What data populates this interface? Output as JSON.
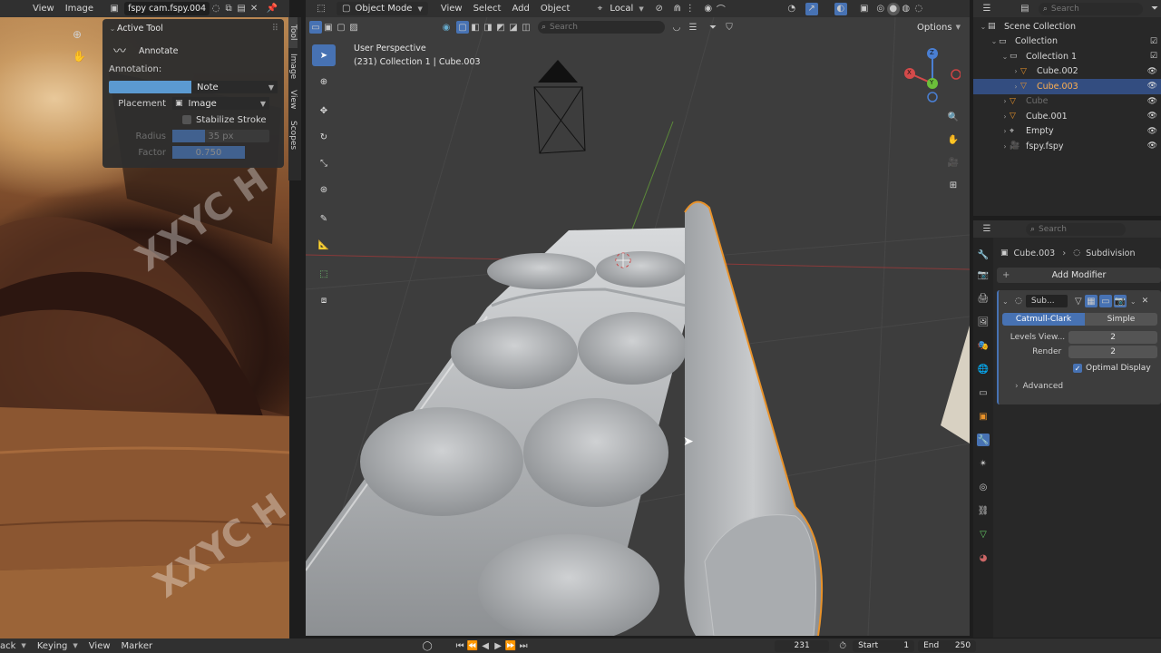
{
  "image_editor": {
    "menus": [
      "View",
      "Image"
    ],
    "image_name": "fspy cam.fspy.004",
    "active_tool": {
      "title": "Active Tool",
      "tool_name": "Annotate",
      "annotation_label": "Annotation:",
      "note_value": "Note",
      "placement_label": "Placement",
      "placement_value": "Image",
      "stabilize_label": "Stabilize Stroke",
      "radius_label": "Radius",
      "radius_value": "35 px",
      "factor_label": "Factor",
      "factor_value": "0.750",
      "note_color": "#5b9ad1"
    },
    "side_tabs": [
      "Tool",
      "Image",
      "View",
      "Scopes"
    ],
    "watermark": "XXYC H"
  },
  "viewport": {
    "mode": "Object Mode",
    "menus": [
      "View",
      "Select",
      "Add",
      "Object"
    ],
    "transform_orientation": "Local",
    "search_placeholder": "Search",
    "options_label": "Options",
    "perspective": "User Perspective",
    "info": "(231) Collection 1 | Cube.003",
    "gizmo": {
      "x": "X",
      "y": "Y",
      "z": "Z"
    }
  },
  "outliner": {
    "search_placeholder": "Search",
    "items": [
      {
        "label": "Scene Collection",
        "indent": 0,
        "icon": "scene-collection-icon"
      },
      {
        "label": "Collection",
        "indent": 1,
        "icon": "collection-icon"
      },
      {
        "label": "Collection 1",
        "indent": 2,
        "icon": "collection-icon"
      },
      {
        "label": "Cube.002",
        "indent": 3,
        "icon": "mesh-icon"
      },
      {
        "label": "Cube.003",
        "indent": 3,
        "icon": "mesh-icon",
        "selected": true
      },
      {
        "label": "Cube",
        "indent": 2,
        "icon": "mesh-icon",
        "dim": true
      },
      {
        "label": "Cube.001",
        "indent": 2,
        "icon": "mesh-icon"
      },
      {
        "label": "Empty",
        "indent": 2,
        "icon": "empty-icon"
      },
      {
        "label": "fspy.fspy",
        "indent": 2,
        "icon": "camera-icon"
      }
    ]
  },
  "properties": {
    "search_placeholder": "Search",
    "breadcrumb_object": "Cube.003",
    "breadcrumb_modifier": "Subdivision",
    "add_modifier": "Add Modifier",
    "modifier_name": "Sub...",
    "catmull_clark": "Catmull-Clark",
    "simple": "Simple",
    "levels_label": "Levels View...",
    "levels_value": "2",
    "render_label": "Render",
    "render_value": "2",
    "optimal_display": "Optimal Display",
    "advanced": "Advanced",
    "accent": "#4772b3"
  },
  "timeline": {
    "menus": [
      "ack",
      "Keying",
      "View",
      "Marker"
    ],
    "current_frame": "231",
    "start_label": "Start",
    "start_value": "1",
    "end_label": "End",
    "end_value": "250"
  }
}
